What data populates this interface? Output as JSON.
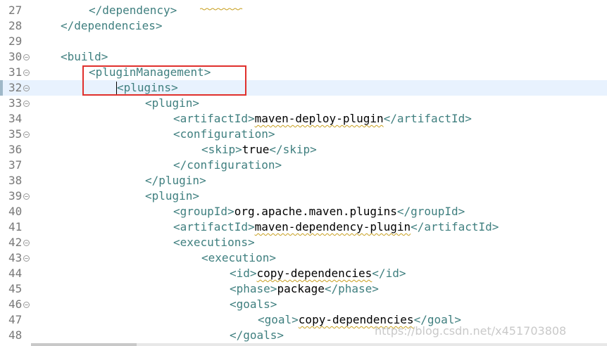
{
  "editor": {
    "lines": [
      {
        "num": "27",
        "indent": 3,
        "text": "</dependency>",
        "fold": false
      },
      {
        "num": "28",
        "indent": 2,
        "text": "</dependencies>",
        "fold": false
      },
      {
        "num": "29",
        "indent": 0,
        "text": "",
        "fold": false
      },
      {
        "num": "30",
        "indent": 2,
        "text": "<build>",
        "fold": true
      },
      {
        "num": "31",
        "indent": 3,
        "text": "<pluginManagement>",
        "fold": true
      },
      {
        "num": "32",
        "indent": 4,
        "text": "<plugins>",
        "fold": true
      },
      {
        "num": "33",
        "indent": 5,
        "text": "<plugin>",
        "fold": true
      },
      {
        "num": "34",
        "indent": 6,
        "text": "<artifactId>maven-deploy-plugin</artifactId>",
        "fold": false
      },
      {
        "num": "35",
        "indent": 6,
        "text": "<configuration>",
        "fold": true
      },
      {
        "num": "36",
        "indent": 7,
        "text": "<skip>true</skip>",
        "fold": false
      },
      {
        "num": "37",
        "indent": 6,
        "text": "</configuration>",
        "fold": false
      },
      {
        "num": "38",
        "indent": 5,
        "text": "</plugin>",
        "fold": false
      },
      {
        "num": "39",
        "indent": 5,
        "text": "<plugin>",
        "fold": true
      },
      {
        "num": "40",
        "indent": 6,
        "text": "<groupId>org.apache.maven.plugins</groupId>",
        "fold": false
      },
      {
        "num": "41",
        "indent": 6,
        "text": "<artifactId>maven-dependency-plugin</artifactId>",
        "fold": false
      },
      {
        "num": "42",
        "indent": 6,
        "text": "<executions>",
        "fold": true
      },
      {
        "num": "43",
        "indent": 7,
        "text": "<execution>",
        "fold": true
      },
      {
        "num": "44",
        "indent": 8,
        "text": "<id>copy-dependencies</id>",
        "fold": false
      },
      {
        "num": "45",
        "indent": 8,
        "text": "<phase>package</phase>",
        "fold": false
      },
      {
        "num": "46",
        "indent": 8,
        "text": "<goals>",
        "fold": true
      },
      {
        "num": "47",
        "indent": 9,
        "text": "<goal>copy-dependencies</goal>",
        "fold": false
      },
      {
        "num": "48",
        "indent": 8,
        "text": "</goals>",
        "fold": false
      }
    ],
    "current_line": "32",
    "highlighted_lines": [
      "31",
      "32"
    ],
    "squiggle_words": [
      "maven-deploy-plugin",
      "maven-dependency-plugin",
      "copy-dependencies"
    ]
  },
  "watermark": "https://blog.csdn.net/x451703808",
  "colors": {
    "tag": "#3f7f7f",
    "text": "#000000",
    "line_number": "#787878",
    "current_line_bg": "#e8f2fe",
    "annotation_box": "#e0302c"
  }
}
